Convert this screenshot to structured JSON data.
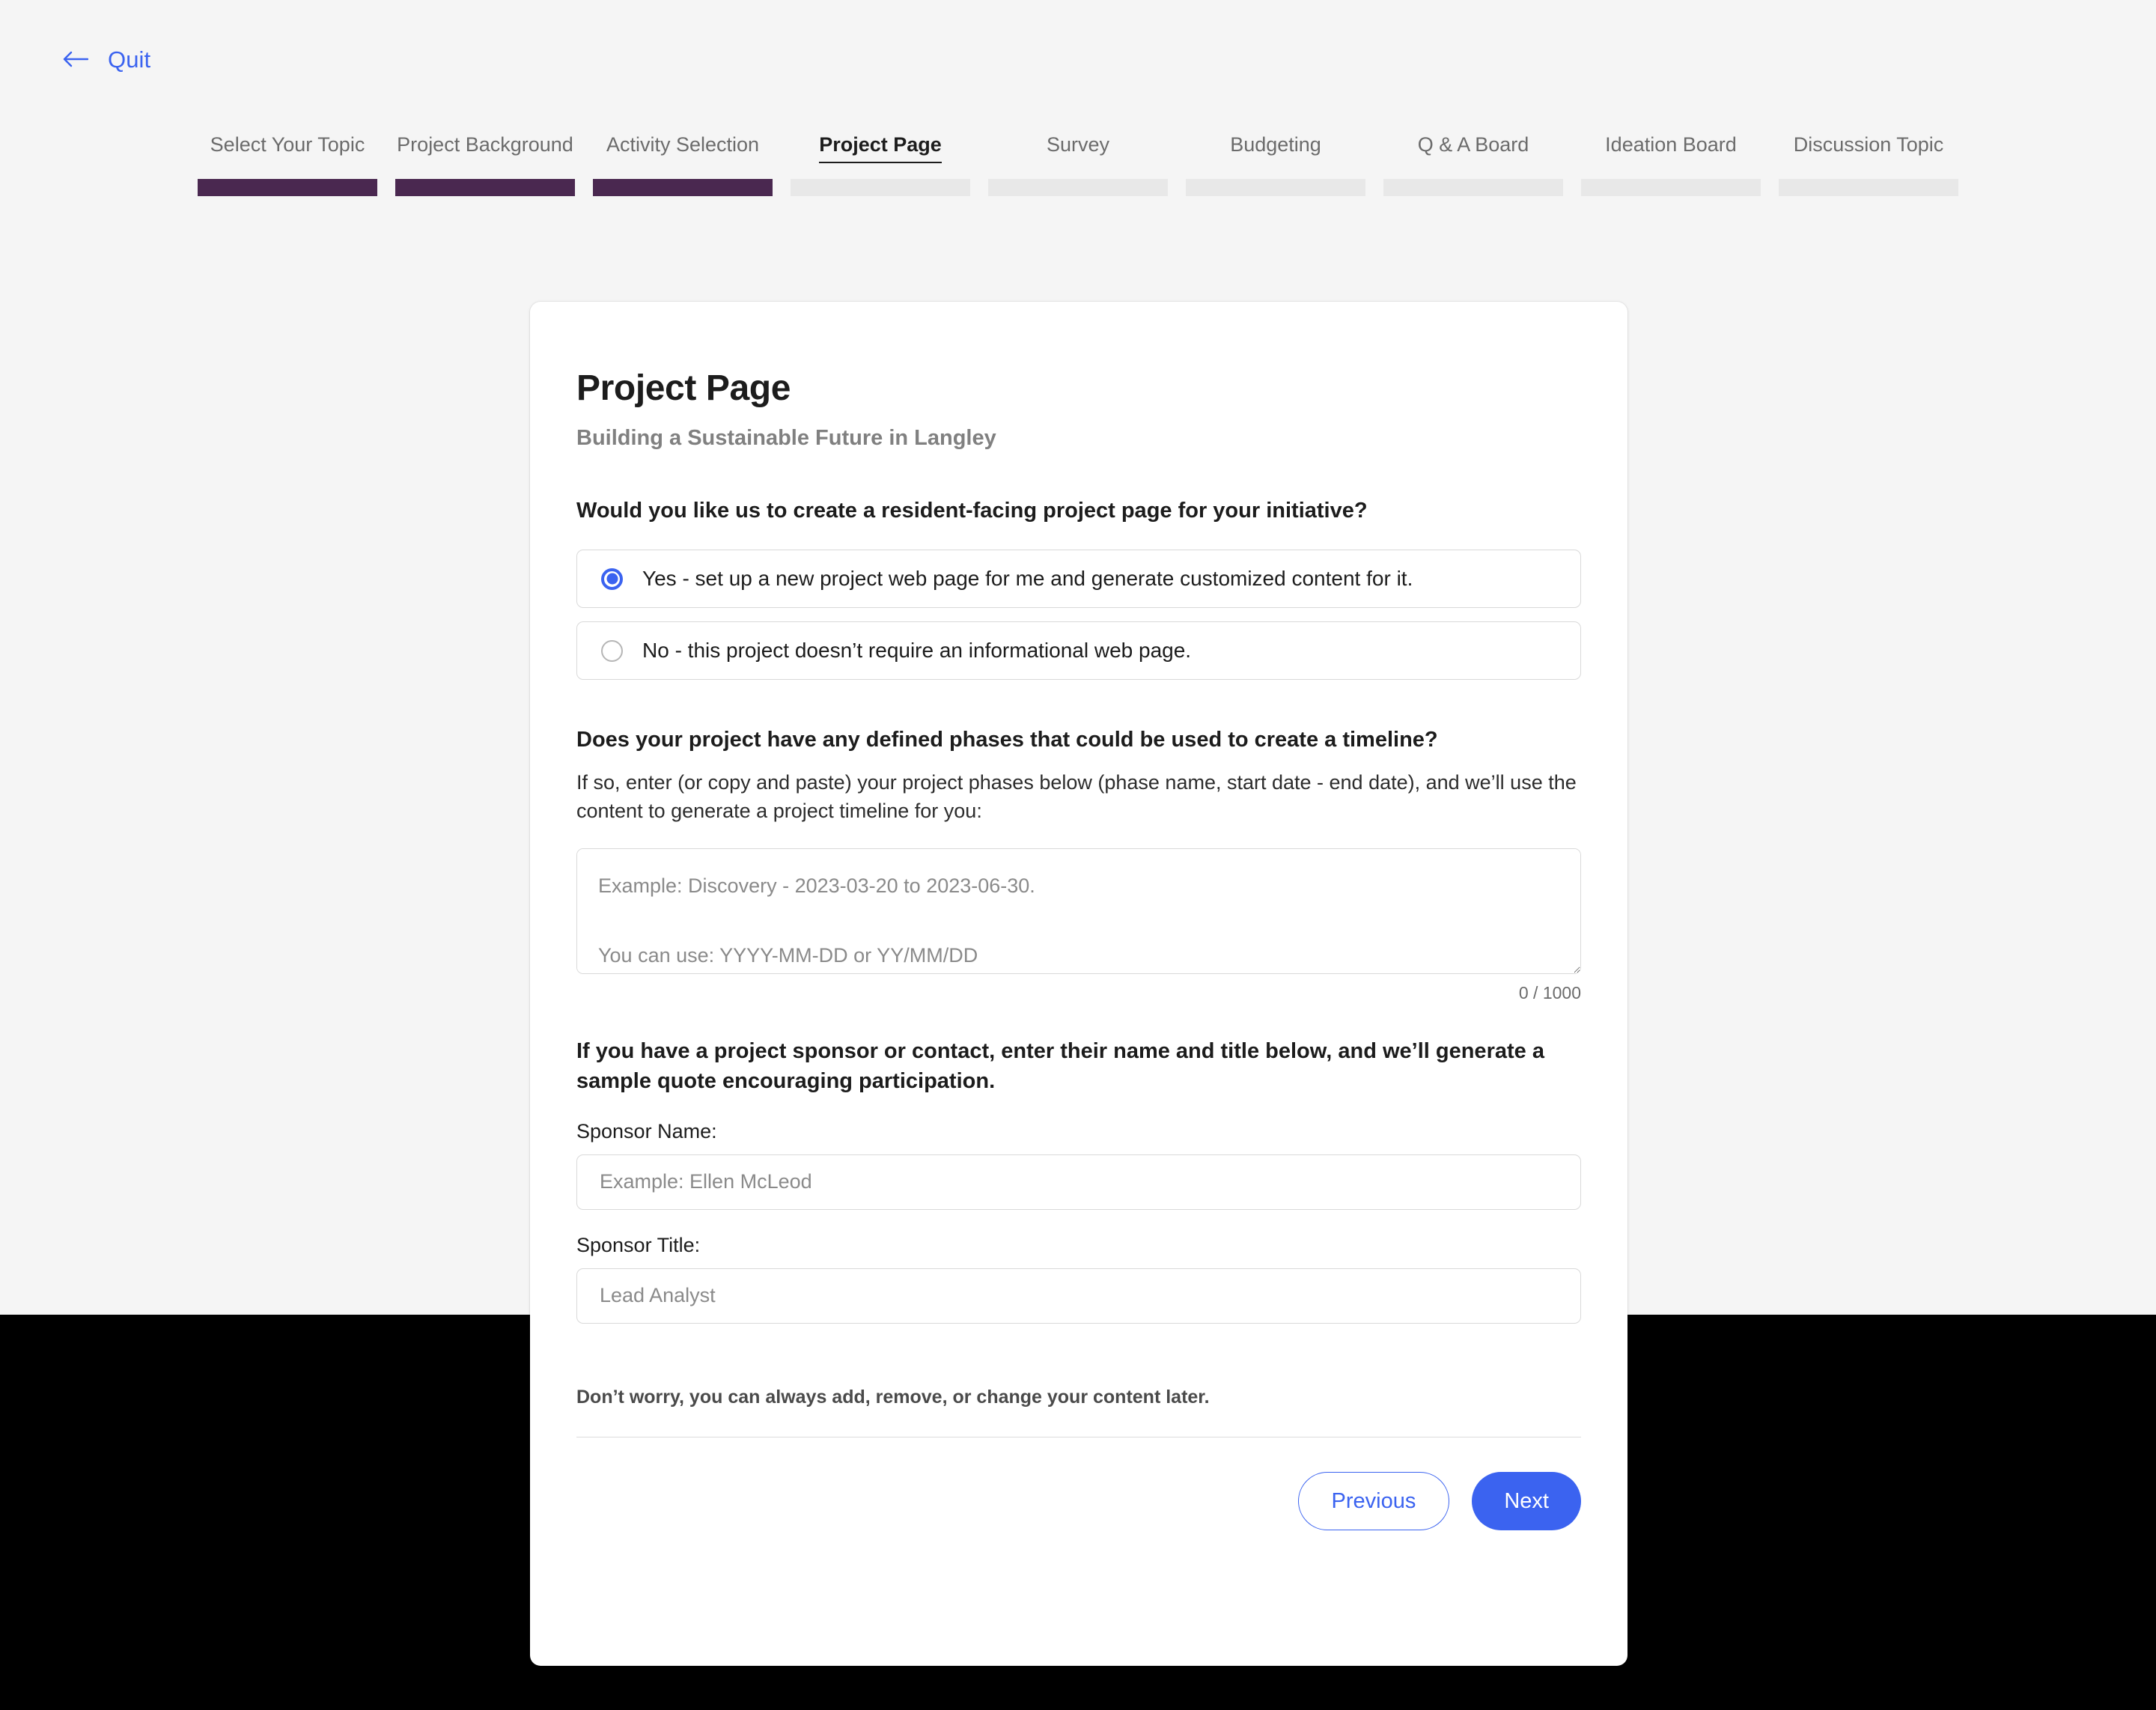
{
  "topbar": {
    "quit_label": "Quit",
    "back_arrow_icon": "arrow-left-icon"
  },
  "stepper": {
    "steps": [
      {
        "label": "Select Your Topic",
        "state": "done"
      },
      {
        "label": "Project Background",
        "state": "done"
      },
      {
        "label": "Activity Selection",
        "state": "done"
      },
      {
        "label": "Project Page",
        "state": "current"
      },
      {
        "label": "Survey",
        "state": "upcoming"
      },
      {
        "label": "Budgeting",
        "state": "upcoming"
      },
      {
        "label": "Q & A Board",
        "state": "upcoming"
      },
      {
        "label": "Ideation Board",
        "state": "upcoming"
      },
      {
        "label": "Discussion Topic",
        "state": "upcoming"
      }
    ]
  },
  "card": {
    "title": "Project Page",
    "subtitle": "Building a Sustainable Future in Langley",
    "question_one": {
      "heading": "Would you like us to create a resident-facing project page for your initiative?",
      "options": [
        {
          "label": "Yes - set up a new project web page for me and generate customized content for it.",
          "selected": true
        },
        {
          "label": "No - this project doesn’t require an informational web page.",
          "selected": false
        }
      ]
    },
    "question_two": {
      "heading": "Does your project have any defined phases that could be used to create a timeline?",
      "description": "If so, enter (or copy and paste) your project phases below (phase name, start date - end date), and we’ll use the content to generate a project timeline for you:",
      "textarea_value": "",
      "textarea_placeholder": "Example: Discovery - 2023-03-20 to 2023-06-30.\n\nYou can use: YYYY-MM-DD or YY/MM/DD",
      "char_count": "0 / 1000"
    },
    "question_three": {
      "heading": "If you have a project sponsor or contact, enter their name and title below, and we’ll generate a sample quote encouraging participation.",
      "sponsor_name_label": "Sponsor Name:",
      "sponsor_name_value": "",
      "sponsor_name_placeholder": "Example: Ellen McLeod",
      "sponsor_title_label": "Sponsor Title:",
      "sponsor_title_value": "",
      "sponsor_title_placeholder": "Lead Analyst"
    },
    "footer": {
      "note": "Don’t worry, you can always add, remove, or change your content later.",
      "previous_label": "Previous",
      "next_label": "Next"
    }
  },
  "colors": {
    "accent_blue": "#3b63f0",
    "step_done_purple": "#4a2850",
    "step_upcoming_grey": "#e8e8e8",
    "page_background": "#f5f5f5",
    "card_background": "#ffffff",
    "outside_band": "#000000"
  }
}
